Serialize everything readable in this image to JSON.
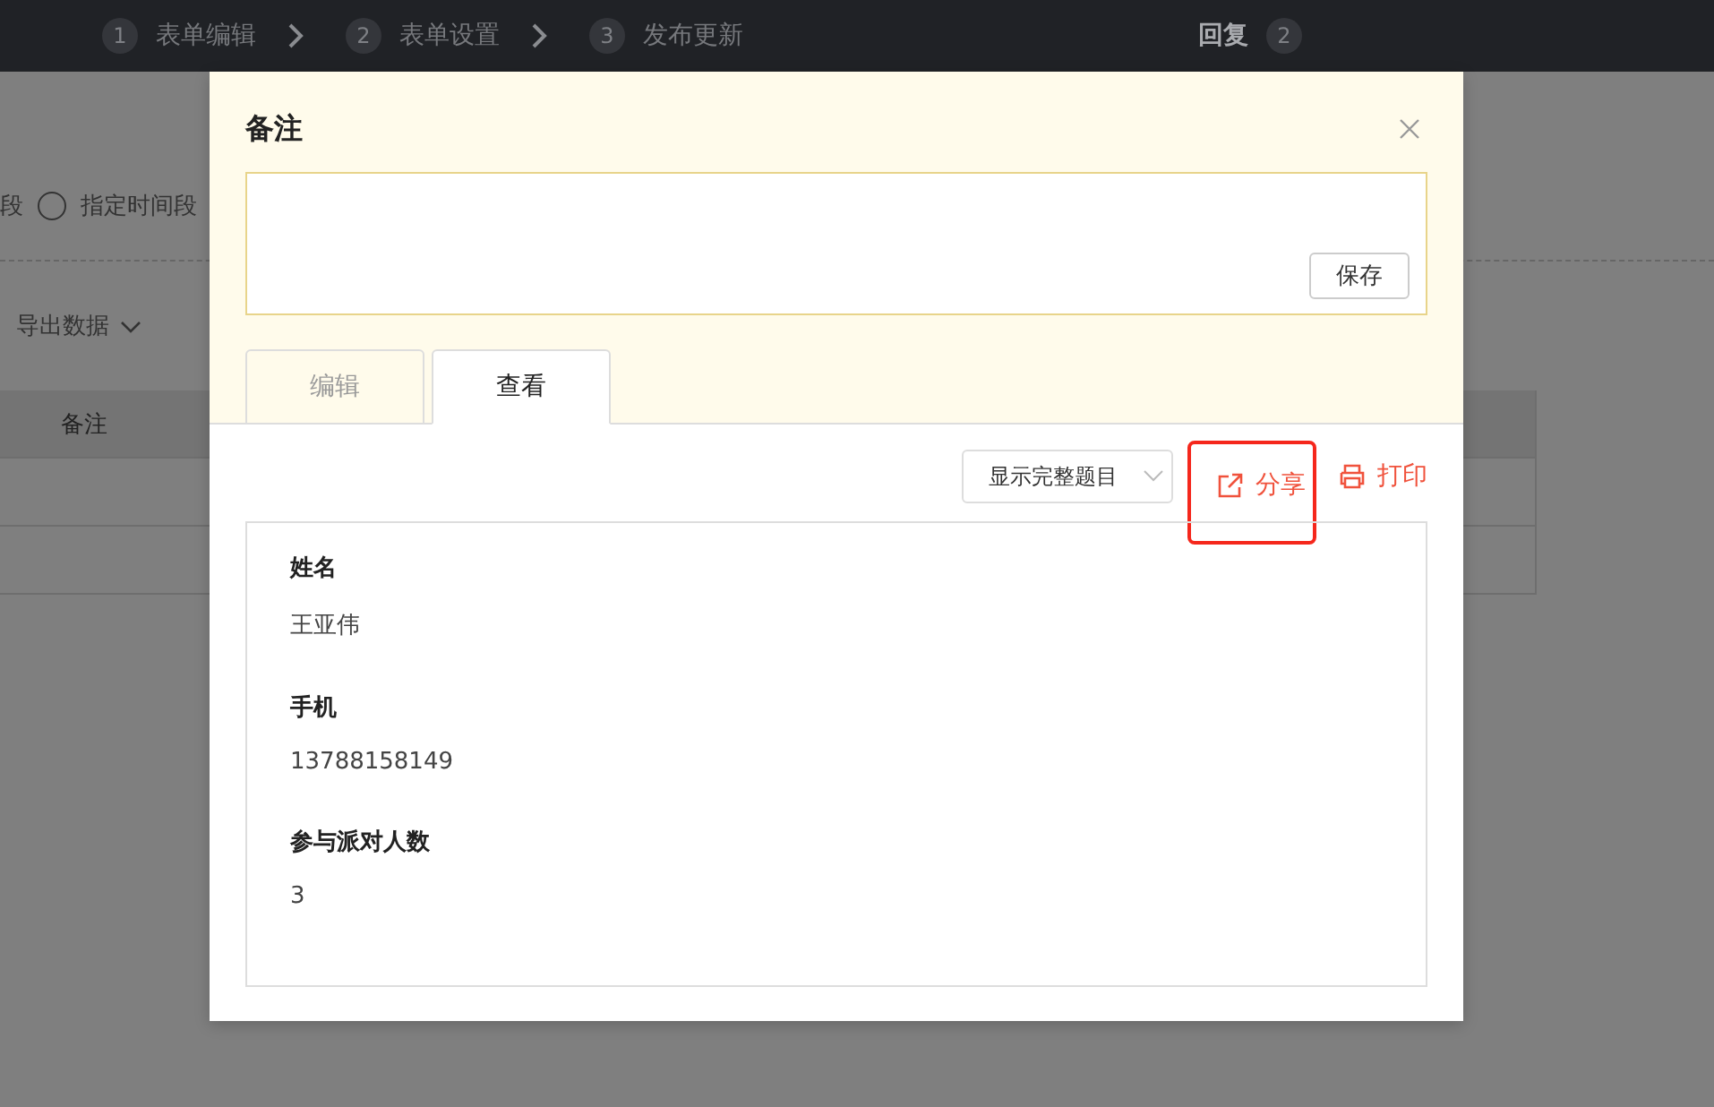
{
  "steps": [
    {
      "number": "1",
      "label": "表单编辑"
    },
    {
      "number": "2",
      "label": "表单设置"
    },
    {
      "number": "3",
      "label": "发布更新"
    }
  ],
  "reply": {
    "label": "回复",
    "count": "2"
  },
  "background": {
    "range_cut": "段",
    "radio": {
      "label": "指定时间段",
      "selected": false
    },
    "export": "导出数据",
    "table": {
      "columns": [
        "备注"
      ]
    }
  },
  "dialog": {
    "title": "备注",
    "save": "保存",
    "tabs": [
      {
        "label": "编辑",
        "selected": false
      },
      {
        "label": "查看",
        "selected": true
      }
    ],
    "display_select": "显示完整题目",
    "share": "分享",
    "share_highlighted": true,
    "print": "打印",
    "fields": [
      {
        "label": "姓名",
        "value": "王亚伟"
      },
      {
        "label": "手机",
        "value": "13788158149"
      },
      {
        "label": "参与派对人数",
        "value": "3"
      }
    ]
  }
}
